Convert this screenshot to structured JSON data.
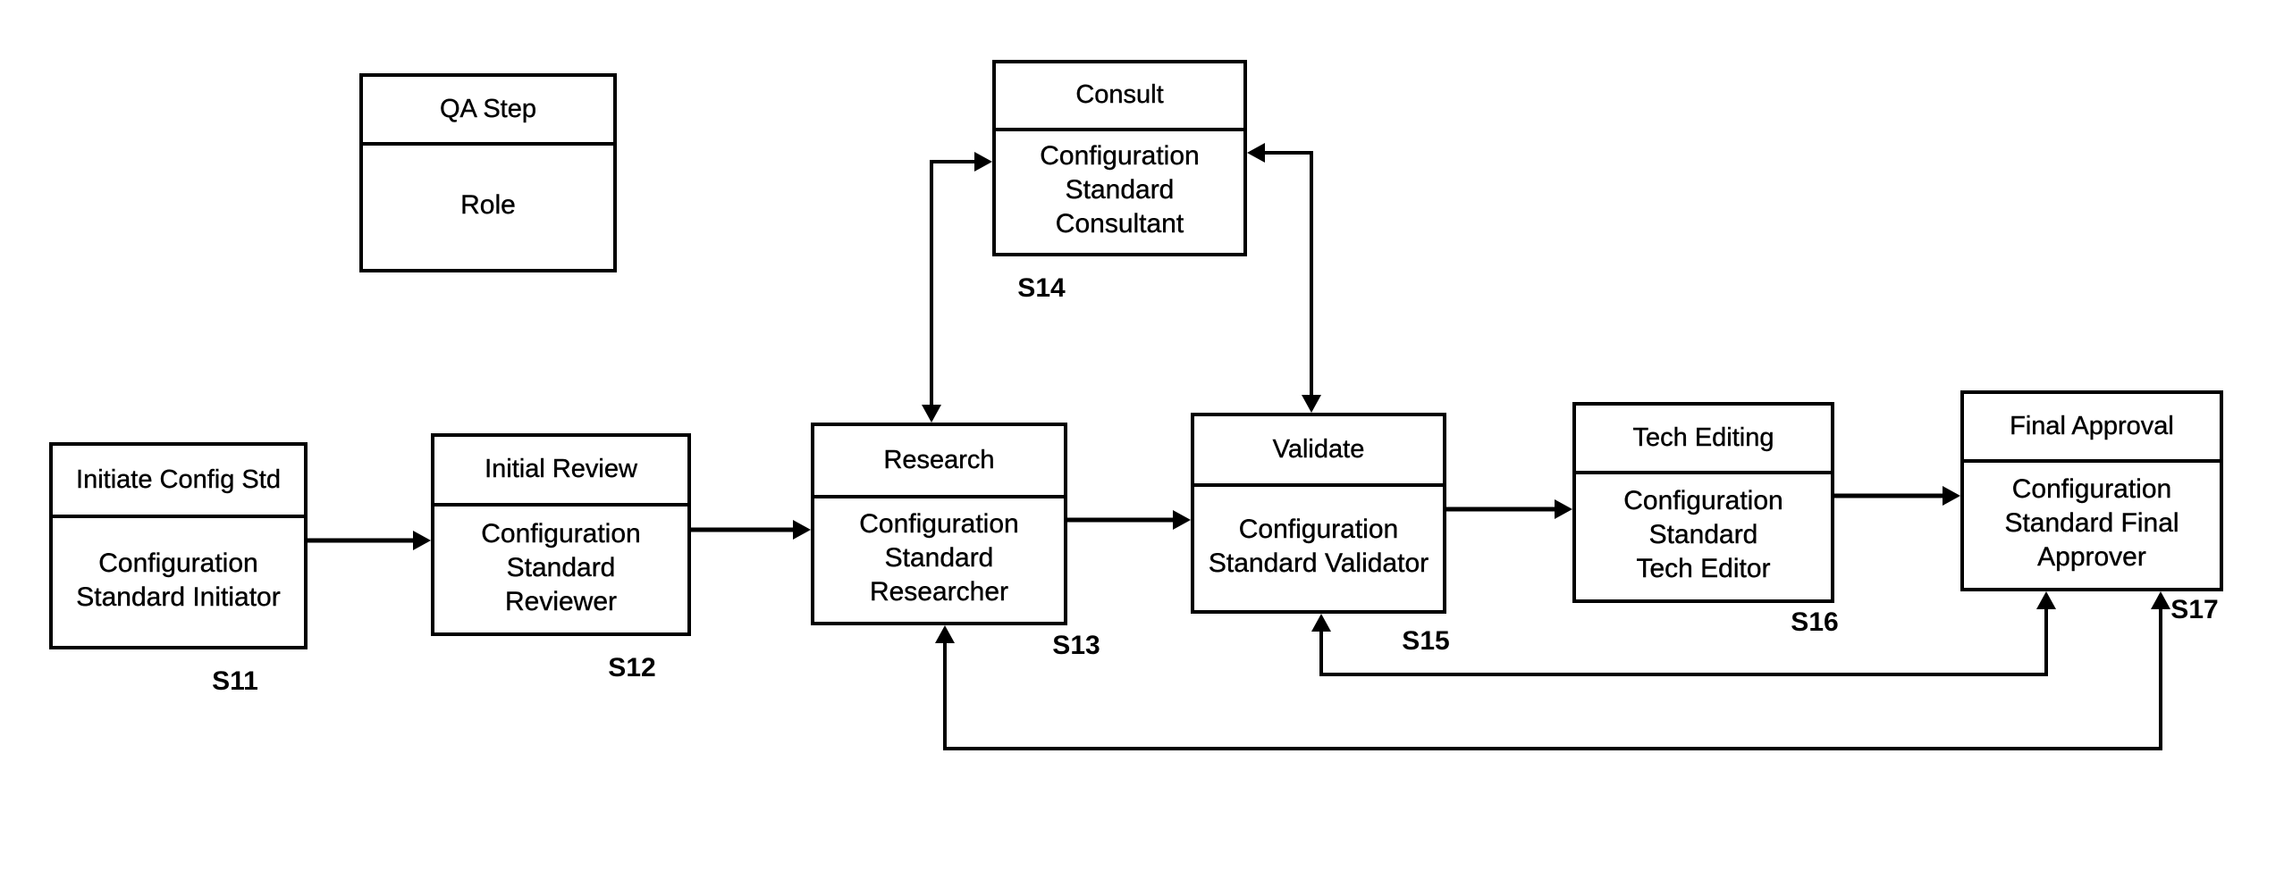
{
  "legend": {
    "header": "QA Step",
    "body": [
      "Role"
    ]
  },
  "steps": [
    {
      "id": "S11",
      "header": "Initiate Config Std",
      "role": [
        "Configuration",
        "Standard Initiator"
      ]
    },
    {
      "id": "S12",
      "header": "Initial Review",
      "role": [
        "Configuration",
        "Standard",
        "Reviewer"
      ]
    },
    {
      "id": "S13",
      "header": "Research",
      "role": [
        "Configuration",
        "Standard",
        "Researcher"
      ]
    },
    {
      "id": "S14",
      "header": "Consult",
      "role": [
        "Configuration",
        "Standard",
        "Consultant"
      ]
    },
    {
      "id": "S15",
      "header": "Validate",
      "role": [
        "Configuration",
        "Standard Validator"
      ]
    },
    {
      "id": "S16",
      "header": "Tech Editing",
      "role": [
        "Configuration",
        "Standard",
        "Tech Editor"
      ]
    },
    {
      "id": "S17",
      "header": "Final Approval",
      "role": [
        "Configuration",
        "Standard Final",
        "Approver"
      ]
    }
  ],
  "connections": [
    {
      "from": "S11",
      "to": "S12",
      "type": "forward"
    },
    {
      "from": "S12",
      "to": "S13",
      "type": "forward"
    },
    {
      "from": "S13",
      "to": "S15",
      "type": "forward"
    },
    {
      "from": "S15",
      "to": "S16",
      "type": "forward"
    },
    {
      "from": "S16",
      "to": "S17",
      "type": "forward"
    },
    {
      "from": "S13",
      "to": "S14",
      "type": "bidirectional"
    },
    {
      "from": "S15",
      "to": "S14",
      "type": "bidirectional"
    },
    {
      "from": "S17",
      "to": "S15",
      "type": "bidirectional-loop"
    },
    {
      "from": "S17",
      "to": "S13",
      "type": "bidirectional-loop"
    }
  ]
}
